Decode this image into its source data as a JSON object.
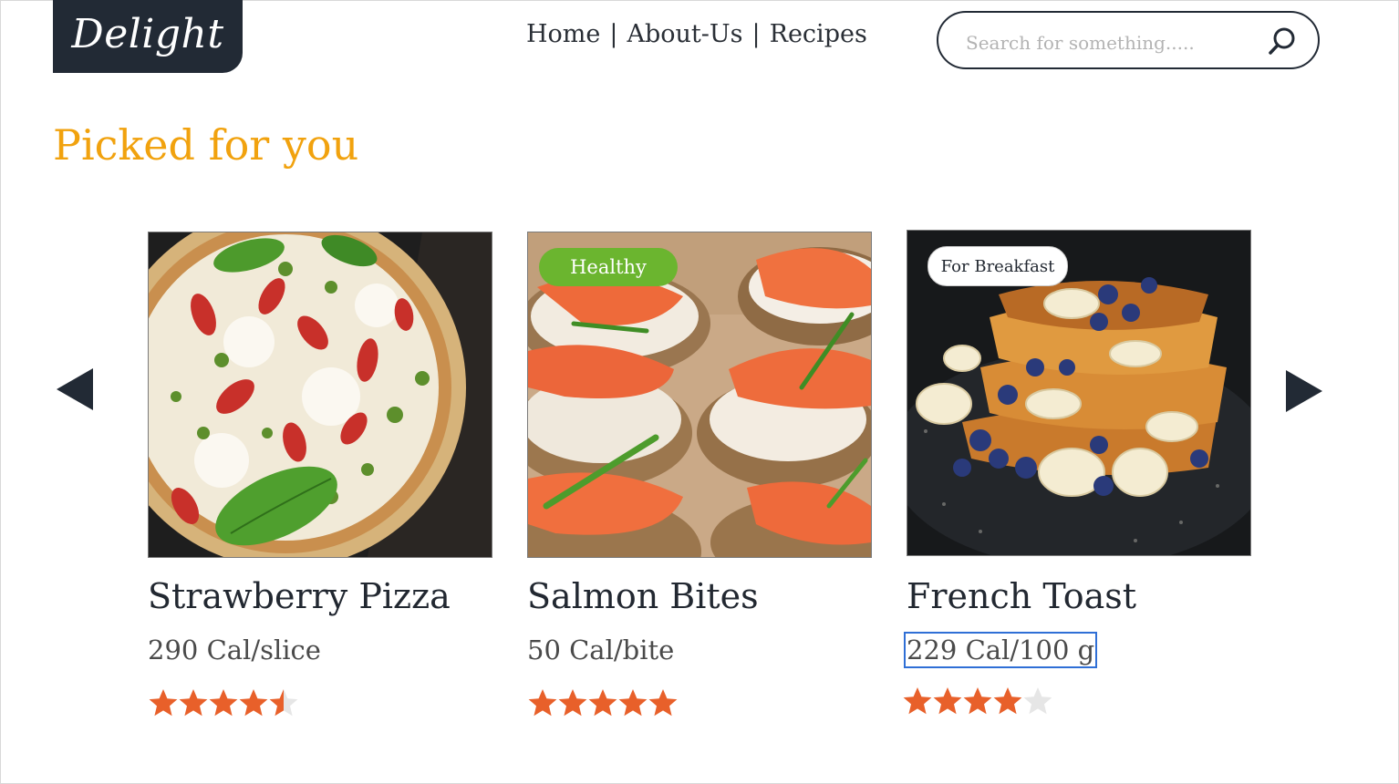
{
  "brand": {
    "logo_text": "Delight",
    "bg_color": "#222a35"
  },
  "nav": {
    "items": [
      {
        "label": "Home"
      },
      {
        "label": "About-Us"
      },
      {
        "label": "Recipes"
      }
    ],
    "separator": "|"
  },
  "search": {
    "placeholder": "Search for something.....",
    "value": "",
    "icon": "search-icon"
  },
  "section": {
    "heading": "Picked for you",
    "heading_color": "#f1a20e"
  },
  "carousel": {
    "prev_icon": "triangle-left-icon",
    "next_icon": "triangle-right-icon",
    "cards": [
      {
        "title": "Strawberry Pizza",
        "calories": "290 Cal/slice",
        "rating": 4.5,
        "max_rating": 5,
        "badge": ""
      },
      {
        "title": "Salmon Bites",
        "calories": "50 Cal/bite",
        "rating": 5,
        "max_rating": 5,
        "badge": "Healthy"
      },
      {
        "title": "French Toast",
        "calories": "229 Cal/100 g",
        "rating": 4,
        "max_rating": 5,
        "badge": "For Breakfast"
      }
    ]
  },
  "colors": {
    "star_filled": "#e8602a",
    "star_empty": "#e6e6e6",
    "healthy_badge": "#6bb52f",
    "selection_outline": "#2f6fd6"
  }
}
